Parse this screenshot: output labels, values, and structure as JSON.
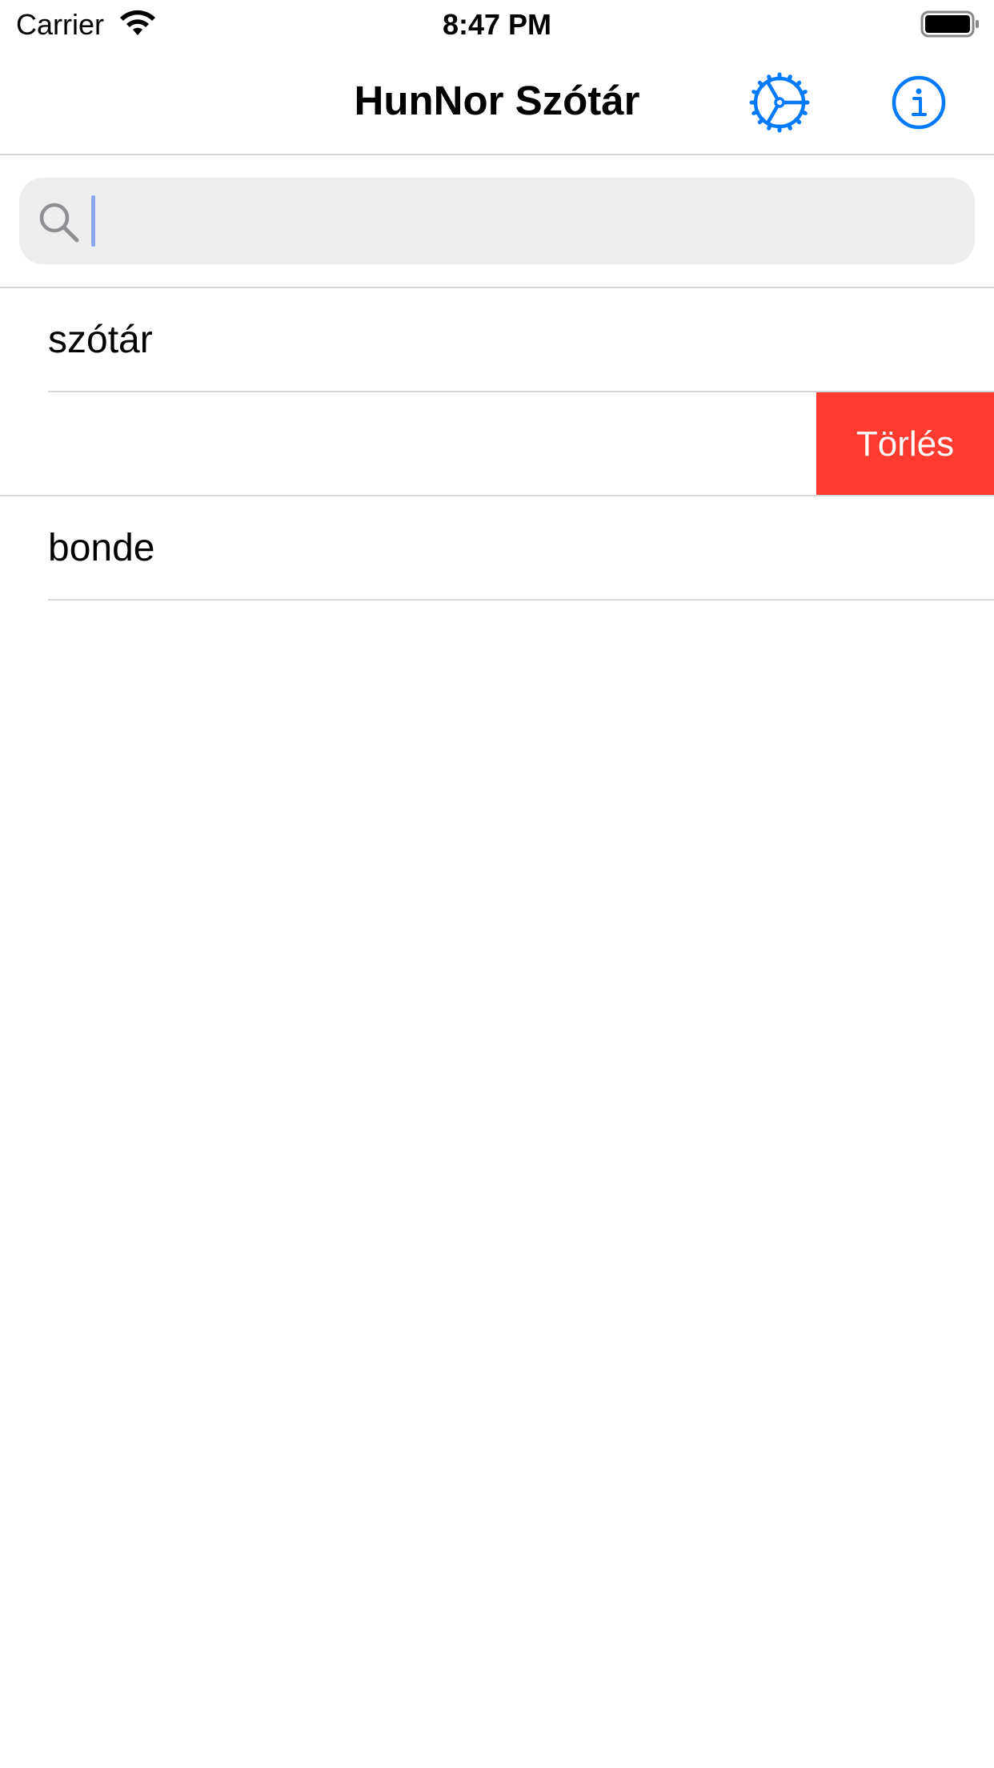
{
  "status_bar": {
    "carrier": "Carrier",
    "time": "8:47 PM",
    "wifi_icon": "wifi-icon",
    "battery_icon": "battery-full-icon"
  },
  "nav_bar": {
    "title": "HunNor Szótár",
    "settings_icon": "steering-wheel-gear-icon",
    "info_icon": "info-circle-icon",
    "accent_color": "#007aff"
  },
  "search": {
    "value": "",
    "placeholder": "",
    "icon": "search-icon"
  },
  "history": {
    "items": [
      {
        "label": "szótár"
      },
      {
        "label": "",
        "swipe_action": "Törlés"
      },
      {
        "label": "bonde"
      }
    ],
    "delete_color": "#ff3b30"
  }
}
